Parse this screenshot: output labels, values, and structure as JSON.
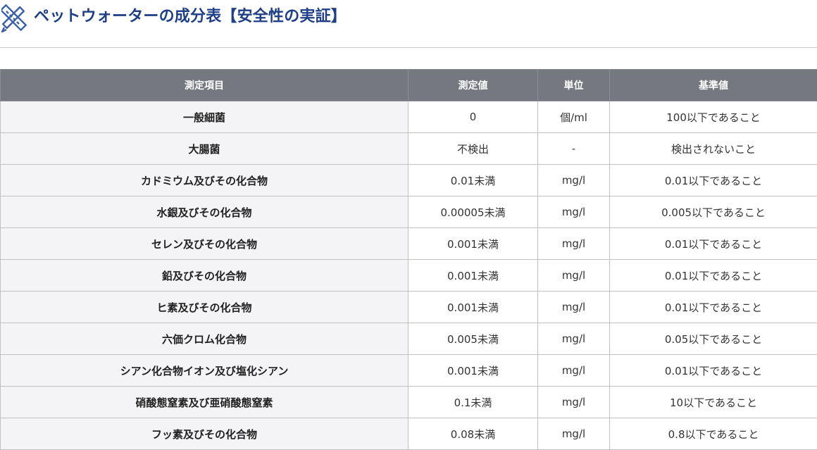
{
  "heading": {
    "title": "ペットウォーターの成分表【安全性の実証】",
    "icon": "ruler-pencil-icon",
    "icon_color": "#3a5fa8",
    "title_color": "#1e3f87"
  },
  "table": {
    "header_bg": "#75797f",
    "columns": [
      "測定項目",
      "測定値",
      "単位",
      "基準値"
    ],
    "rows": [
      {
        "item": "一般細菌",
        "value": "0",
        "unit": "個/ml",
        "standard": "100以下であること"
      },
      {
        "item": "大腸菌",
        "value": "不検出",
        "unit": "-",
        "standard": "検出されないこと"
      },
      {
        "item": "カドミウム及びその化合物",
        "value": "0.01未満",
        "unit": "mg/l",
        "standard": "0.01以下であること"
      },
      {
        "item": "水銀及びその化合物",
        "value": "0.00005未満",
        "unit": "mg/l",
        "standard": "0.005以下であること"
      },
      {
        "item": "セレン及びその化合物",
        "value": "0.001未満",
        "unit": "mg/l",
        "standard": "0.01以下であること"
      },
      {
        "item": "鉛及びその化合物",
        "value": "0.001未満",
        "unit": "mg/l",
        "standard": "0.01以下であること"
      },
      {
        "item": "ヒ素及びその化合物",
        "value": "0.001未満",
        "unit": "mg/l",
        "standard": "0.01以下であること"
      },
      {
        "item": "六価クロム化合物",
        "value": "0.005未満",
        "unit": "mg/l",
        "standard": "0.05以下であること"
      },
      {
        "item": "シアン化合物イオン及び塩化シアン",
        "value": "0.001未満",
        "unit": "mg/l",
        "standard": "0.01以下であること"
      },
      {
        "item": "硝酸態窒素及び亜硝酸態窒素",
        "value": "0.1未満",
        "unit": "mg/l",
        "standard": "10以下であること"
      },
      {
        "item": "フッ素及びその化合物",
        "value": "0.08未満",
        "unit": "mg/l",
        "standard": "0.8以下であること"
      }
    ]
  }
}
